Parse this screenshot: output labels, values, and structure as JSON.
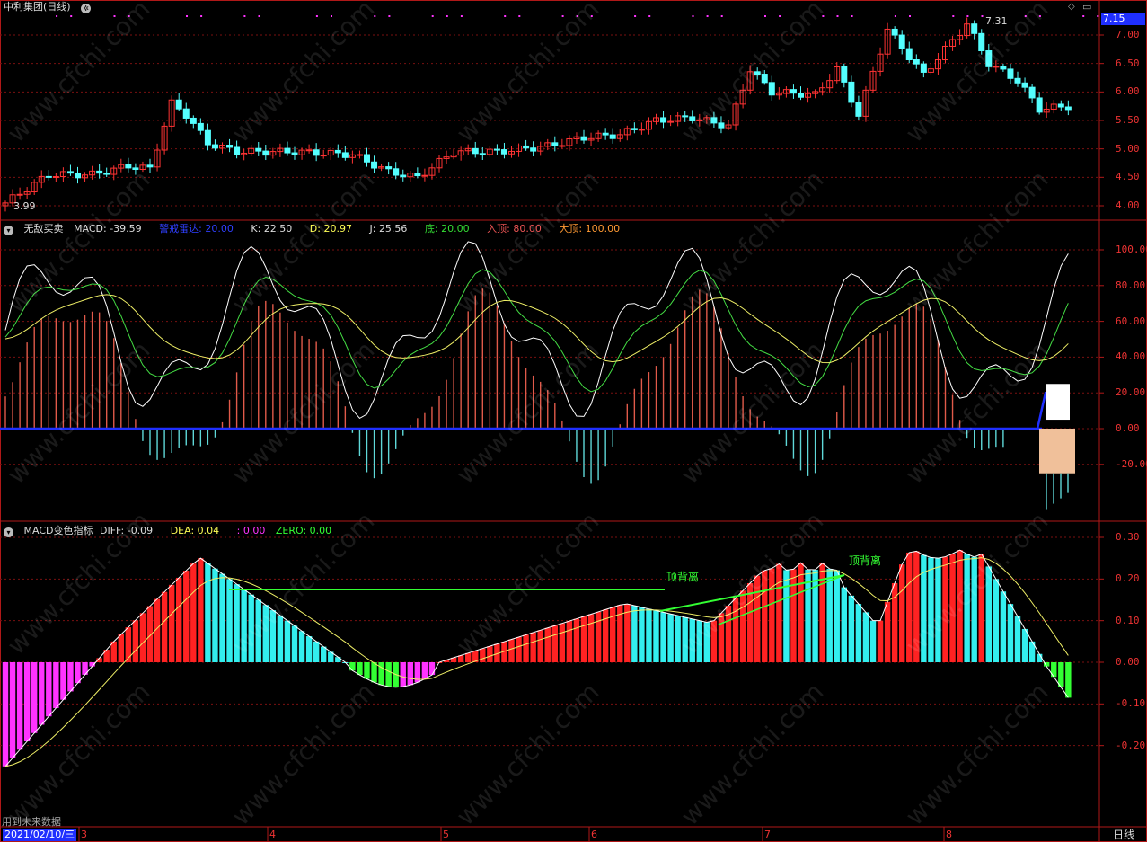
{
  "stock": {
    "name": "中利集团",
    "period": "(日线)",
    "high_mark": "7.31",
    "low_mark": "3.99",
    "current_price": "7.15"
  },
  "panel1": {
    "yticks": [
      "7.00",
      "6.50",
      "6.00",
      "5.50",
      "5.00",
      "4.50",
      "4.00"
    ]
  },
  "panel2": {
    "name": "无敌买卖",
    "macd_label": "MACD:",
    "macd_value": "-39.59",
    "alert_label": "警戒雷达:",
    "alert_value": "20.00",
    "k_label": "K:",
    "k_value": "22.50",
    "d_label": "D:",
    "d_value": "20.97",
    "j_label": "J:",
    "j_value": "25.56",
    "bottom_label": "底:",
    "bottom_value": "20.00",
    "entry_top_label": "入顶:",
    "entry_top_value": "80.00",
    "big_top_label": "大顶:",
    "big_top_value": "100.00",
    "yticks": [
      "100.00",
      "80.00",
      "60.00",
      "40.00",
      "20.00",
      "0.00",
      "-20.00"
    ]
  },
  "panel3": {
    "name": "MACD变色指标",
    "diff_label": "DIFF:",
    "diff_value": "-0.09",
    "dea_label": "DEA:",
    "dea_value": "0.04",
    "macd_value": ": 0.00",
    "zero_label": "ZERO:",
    "zero_value": "0.00",
    "annotation1": "顶背离",
    "annotation2": "顶背离",
    "yticks": [
      "0.30",
      "0.20",
      "0.10",
      "0.00",
      "-0.10",
      "-0.20"
    ]
  },
  "footer": {
    "note": "用到未来数据",
    "date": "2021/02/10/三",
    "months": [
      "3",
      "4",
      "5",
      "6",
      "7",
      "8"
    ],
    "period_button": "日线"
  },
  "colors": {
    "up": "#ff3333",
    "down": "#54ffff",
    "grid": "#7a1010",
    "border": "#b01818",
    "blue": "#1f2fff",
    "magenta": "#ff33ff",
    "green": "#33ff33",
    "yellow": "#ffff66"
  },
  "watermark": "www.cfchi.com"
}
